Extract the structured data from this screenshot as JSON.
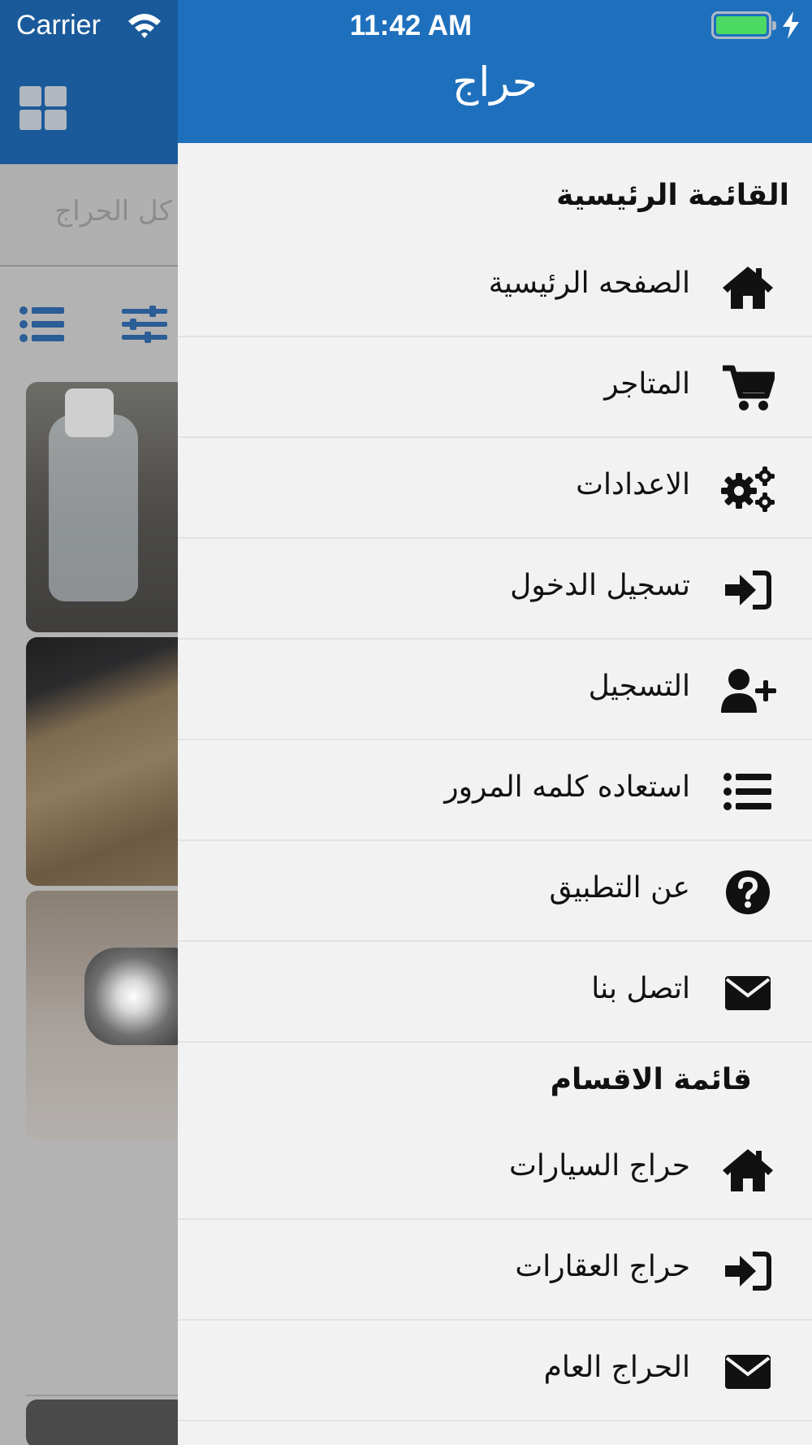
{
  "status_bar": {
    "carrier": "Carrier",
    "time": "11:42 AM"
  },
  "background_screen": {
    "search_placeholder": "كل الحراج"
  },
  "drawer": {
    "title": "حراج",
    "main_section_title": "القائمة الرئيسية",
    "main_items": [
      {
        "label": "الصفحه الرئيسية",
        "icon": "home-icon"
      },
      {
        "label": "المتاجر",
        "icon": "cart-icon"
      },
      {
        "label": "الاعدادات",
        "icon": "gears-icon"
      },
      {
        "label": "تسجيل الدخول",
        "icon": "sign-in-icon"
      },
      {
        "label": "التسجيل",
        "icon": "user-plus-icon"
      },
      {
        "label": "استعاده كلمه المرور",
        "icon": "list-icon"
      },
      {
        "label": "عن التطبيق",
        "icon": "question-circle-icon"
      },
      {
        "label": "اتصل بنا",
        "icon": "envelope-icon"
      }
    ],
    "categories_section_title": "قائمة الاقسام",
    "category_items": [
      {
        "label": "حراج السيارات",
        "icon": "home-icon"
      },
      {
        "label": "حراج العقارات",
        "icon": "sign-in-icon"
      },
      {
        "label": "الحراج العام",
        "icon": "envelope-icon"
      }
    ]
  },
  "colors": {
    "header_blue": "#1e70bd",
    "dim_header": "#1a5a9a",
    "battery_green": "#4cd964",
    "drawer_bg": "#f2f2f2"
  }
}
